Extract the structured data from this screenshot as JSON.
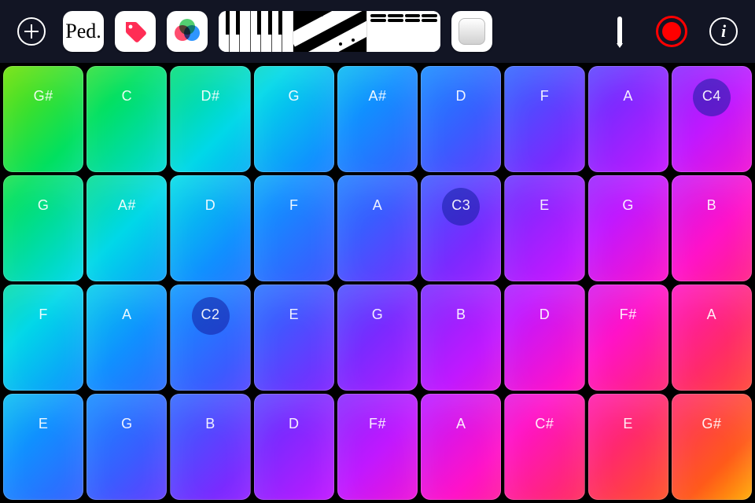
{
  "toolbar": {
    "add": "add",
    "pedal": "Ped.",
    "tag": "tag",
    "color": "color",
    "modes": [
      "keyboard",
      "ribbon",
      "grid"
    ],
    "toggle": "toggle",
    "tool": "tool",
    "record": "record",
    "info": "i"
  },
  "grid": {
    "rows": 4,
    "cols": 9,
    "octave_markers": [
      "C4",
      "C3",
      "C2"
    ],
    "pads": [
      [
        "G♯",
        "C",
        "D♯",
        "G",
        "A♯",
        "D",
        "F",
        "A",
        "C4"
      ],
      [
        "G",
        "A♯",
        "D",
        "F",
        "A",
        "C3",
        "E",
        "G",
        "B"
      ],
      [
        "F",
        "A",
        "C2",
        "E",
        "G",
        "B",
        "D",
        "F♯",
        "A"
      ],
      [
        "E",
        "G",
        "B",
        "D",
        "F♯",
        "A",
        "C♯",
        "E",
        "G♯"
      ]
    ]
  }
}
